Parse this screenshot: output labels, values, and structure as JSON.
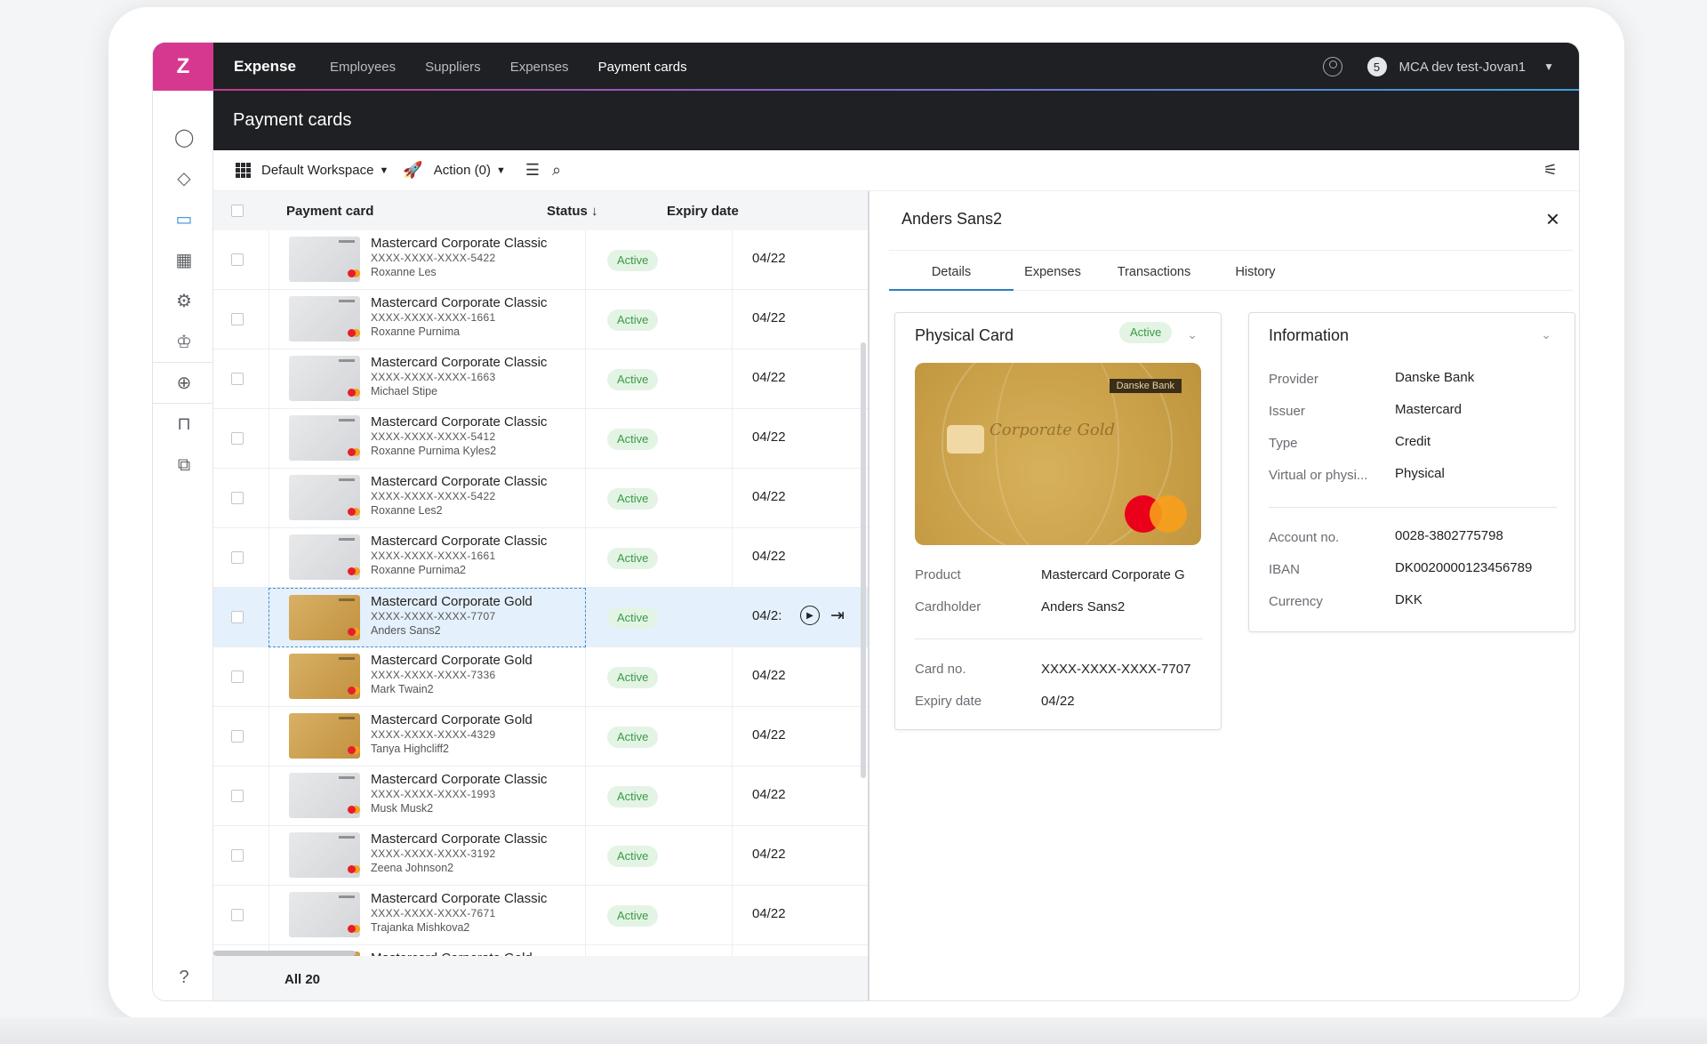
{
  "topbar": {
    "app_name": "Expense",
    "nav": [
      "Employees",
      "Suppliers",
      "Expenses",
      "Payment cards"
    ],
    "active_nav": "Payment cards",
    "notification_count": "5",
    "account_name": "MCA dev test-Jovan1"
  },
  "page_title": "Payment cards",
  "toolbar": {
    "workspace_label": "Default Workspace",
    "action_label": "Action (0)"
  },
  "list": {
    "columns": {
      "payment_card": "Payment card",
      "status": "Status",
      "expiry": "Expiry date"
    },
    "rows": [
      {
        "name": "Mastercard Corporate Classic",
        "number": "XXXX-XXXX-XXXX-5422",
        "holder": "Roxanne Les",
        "status": "Active",
        "expiry": "04/22",
        "type": "classic"
      },
      {
        "name": "Mastercard Corporate Classic",
        "number": "XXXX-XXXX-XXXX-1661",
        "holder": "Roxanne Purnima",
        "status": "Active",
        "expiry": "04/22",
        "type": "classic"
      },
      {
        "name": "Mastercard Corporate Classic",
        "number": "XXXX-XXXX-XXXX-1663",
        "holder": "Michael Stipe",
        "status": "Active",
        "expiry": "04/22",
        "type": "classic"
      },
      {
        "name": "Mastercard Corporate Classic",
        "number": "XXXX-XXXX-XXXX-5412",
        "holder": "Roxanne Purnima Kyles2",
        "status": "Active",
        "expiry": "04/22",
        "type": "classic"
      },
      {
        "name": "Mastercard Corporate Classic",
        "number": "XXXX-XXXX-XXXX-5422",
        "holder": "Roxanne Les2",
        "status": "Active",
        "expiry": "04/22",
        "type": "classic"
      },
      {
        "name": "Mastercard Corporate Classic",
        "number": "XXXX-XXXX-XXXX-1661",
        "holder": "Roxanne Purnima2",
        "status": "Active",
        "expiry": "04/22",
        "type": "classic"
      },
      {
        "name": "Mastercard Corporate Gold",
        "number": "XXXX-XXXX-XXXX-7707",
        "holder": "Anders Sans2",
        "status": "Active",
        "expiry": "04/2:",
        "type": "gold",
        "selected": true
      },
      {
        "name": "Mastercard Corporate Gold",
        "number": "XXXX-XXXX-XXXX-7336",
        "holder": "Mark Twain2",
        "status": "Active",
        "expiry": "04/22",
        "type": "gold"
      },
      {
        "name": "Mastercard Corporate Gold",
        "number": "XXXX-XXXX-XXXX-4329",
        "holder": "Tanya Highcliff2",
        "status": "Active",
        "expiry": "04/22",
        "type": "gold"
      },
      {
        "name": "Mastercard Corporate Classic",
        "number": "XXXX-XXXX-XXXX-1993",
        "holder": "Musk Musk2",
        "status": "Active",
        "expiry": "04/22",
        "type": "classic"
      },
      {
        "name": "Mastercard Corporate Classic",
        "number": "XXXX-XXXX-XXXX-3192",
        "holder": "Zeena Johnson2",
        "status": "Active",
        "expiry": "04/22",
        "type": "classic"
      },
      {
        "name": "Mastercard Corporate Classic",
        "number": "XXXX-XXXX-XXXX-7671",
        "holder": "Trajanka Mishkova2",
        "status": "Active",
        "expiry": "04/22",
        "type": "classic"
      },
      {
        "name": "Mastercard Corporate Gold",
        "number": "",
        "holder": "",
        "status": "",
        "expiry": "",
        "type": "gold"
      }
    ],
    "footer": "All 20"
  },
  "detail": {
    "title": "Anders Sans2",
    "tabs": [
      "Details",
      "Expenses",
      "Transactions",
      "History"
    ],
    "active_tab": "Details",
    "physical_card": {
      "title": "Physical Card",
      "status": "Active",
      "card_brand_text": "Corporate Gold",
      "card_bank_text": "Danske Bank",
      "fields": [
        {
          "label": "Product",
          "value": "Mastercard Corporate G"
        },
        {
          "label": "Cardholder",
          "value": "Anders Sans2"
        },
        {
          "label": "Card no.",
          "value": "XXXX-XXXX-XXXX-7707"
        },
        {
          "label": "Expiry date",
          "value": "04/22"
        }
      ]
    },
    "information": {
      "title": "Information",
      "fields": [
        {
          "label": "Provider",
          "value": "Danske Bank"
        },
        {
          "label": "Issuer",
          "value": "Mastercard"
        },
        {
          "label": "Type",
          "value": "Credit"
        },
        {
          "label": "Virtual or physi...",
          "value": "Physical"
        },
        {
          "label": "Account no.",
          "value": "0028-3802775798"
        },
        {
          "label": "IBAN",
          "value": "DK0020000123456789"
        },
        {
          "label": "Currency",
          "value": "DKK"
        }
      ]
    }
  },
  "colors": {
    "brand": "#d6388f",
    "dark": "#1f2023",
    "active_green": "#3a9a45",
    "selected_row": "#e4f0fb"
  }
}
